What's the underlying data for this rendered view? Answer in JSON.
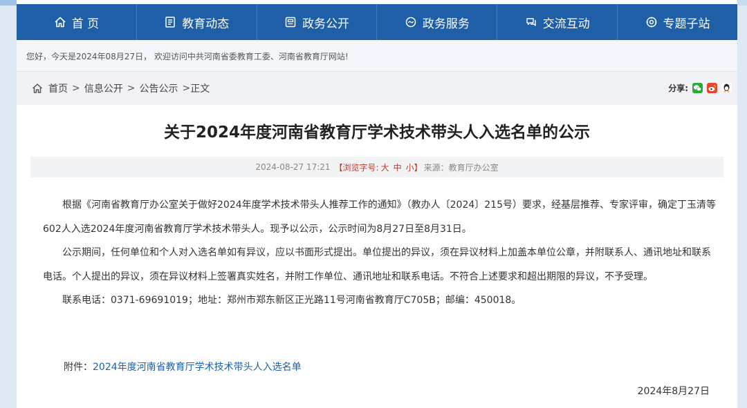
{
  "nav": {
    "items": [
      {
        "label": "首 页",
        "icon": "home-icon"
      },
      {
        "label": "教育动态",
        "icon": "document-icon"
      },
      {
        "label": "政务公开",
        "icon": "bulletin-icon"
      },
      {
        "label": "政务服务",
        "icon": "service-icon"
      },
      {
        "label": "交流互动",
        "icon": "chat-icon"
      },
      {
        "label": "专题子站",
        "icon": "target-icon"
      }
    ]
  },
  "welcome": "您好，今天是2024年08月27日， 欢迎访问中共河南省委教育工委、河南省教育厅网站!",
  "breadcrumb": {
    "home": "首页",
    "sep1": ">",
    "info": "信息公开",
    "sep2": ">",
    "notice": "公告公示",
    "sep3": ">",
    "current": "正文"
  },
  "share": {
    "label": "分享:",
    "icons": [
      "wechat-icon",
      "weibo-icon",
      "qq-icon"
    ]
  },
  "article": {
    "title": "关于2024年度河南省教育厅学术技术带头人入选名单的公示",
    "meta_datetime": "2024-08-27 17:21",
    "meta_fontsize_label": "【浏览字号:",
    "meta_fs_large": "大",
    "meta_fs_medium": "中",
    "meta_fs_small": "小】",
    "meta_source": "来源：教育厅办公室",
    "paragraphs": [
      "根据《河南省教育厅办公室关于做好2024年度学术技术带头人推荐工作的通知》（教办人〔2024〕215号）要求，经基层推荐、专家评审，确定丁玉清等602人入选2024年度河南省教育厅学术技术带头人。现予以公示，公示时间为8月27日至8月31日。",
      "公示期间，任何单位和个人对入选名单如有异议，应以书面形式提出。单位提出的异议，须在异议材料上加盖本单位公章，并附联系人、通讯地址和联系电话。个人提出的异议，须在异议材料上签署真实姓名，并附工作单位、通讯地址和联系电话。不符合上述要求和超出期限的异议，不予受理。",
      "联系电话：0371-69691019；地址：郑州市郑东新区正光路11号河南省教育厅C705B；邮编：450018。"
    ],
    "attachment_label": "附件：",
    "attachment_link": "2024年度河南省教育厅学术技术带头人入选名单",
    "date": "2024年8月27日"
  },
  "colors": {
    "nav_bg": "#1f5fa8",
    "link": "#1f5fa8",
    "accent_red": "#c0392b"
  }
}
